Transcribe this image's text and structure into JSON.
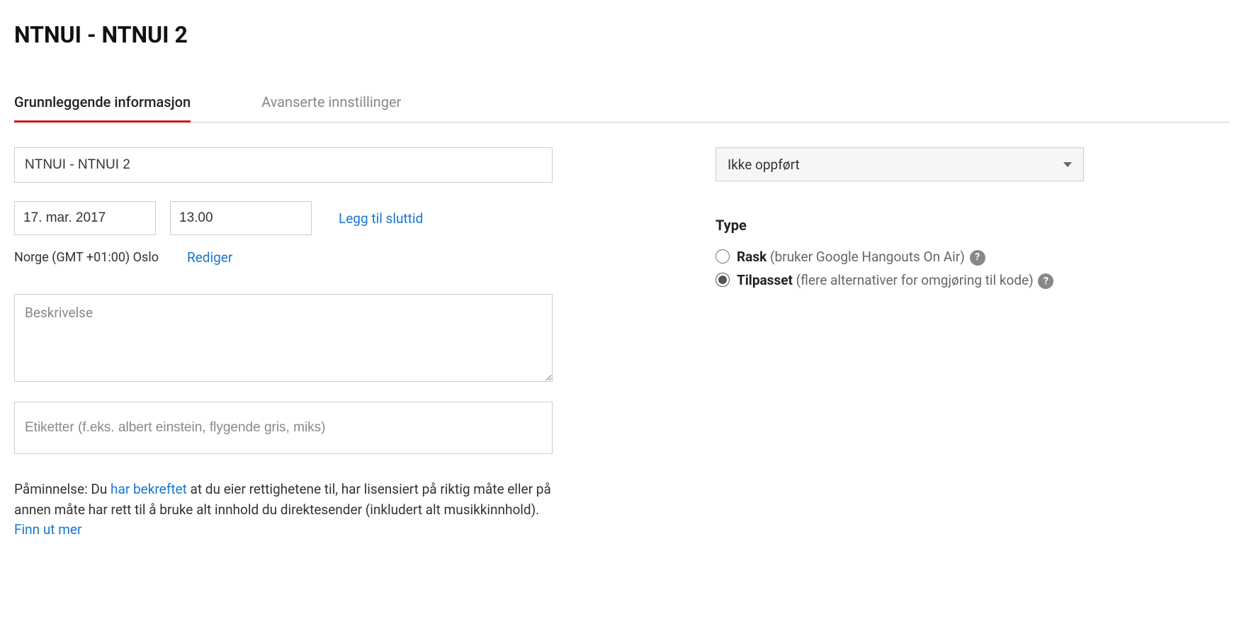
{
  "page_title": "NTNUI - NTNUI 2",
  "tabs": {
    "basic": "Grunnleggende informasjon",
    "advanced": "Avanserte innstillinger"
  },
  "form": {
    "title_value": "NTNUI - NTNUI 2",
    "date_value": "17. mar. 2017",
    "time_value": "13.00",
    "add_end_time": "Legg til sluttid",
    "timezone": "Norge (GMT +01:00) Oslo",
    "edit_tz": "Rediger",
    "description_placeholder": "Beskrivelse",
    "tags_placeholder": "Etiketter (f.eks. albert einstein, flygende gris, miks)"
  },
  "reminder": {
    "prefix": "Påminnelse: Du ",
    "confirmed_link": "har bekreftet",
    "middle": " at du eier rettighetene til, har lisensiert på riktig måte eller på annen måte har rett til å bruke alt innhold du direktesender (inkludert alt musikkinnhold). ",
    "learn_more": "Finn ut mer"
  },
  "privacy": {
    "selected": "Ikke oppført"
  },
  "type": {
    "heading": "Type",
    "quick_bold": "Rask",
    "quick_rest": " (bruker Google Hangouts On Air) ",
    "custom_bold": "Tilpasset",
    "custom_rest": " (flere alternativer for omgjøring til kode) "
  }
}
